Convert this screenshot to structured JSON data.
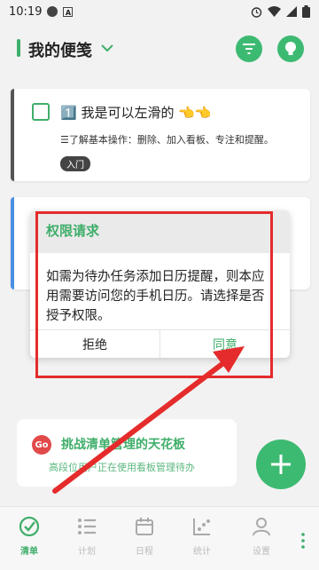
{
  "status_bar": {
    "time": "10:19",
    "badge_letter": "A"
  },
  "header": {
    "title": "我的便笺",
    "filter_icon": "filter-icon",
    "tip_icon": "lightbulb-icon"
  },
  "tasks": [
    {
      "title": "1️⃣ 我是可以左滑的 👈👈",
      "desc": "☰了解基本操作：删除、加入看板、专注和提醒。",
      "tag": "入门"
    }
  ],
  "dialog": {
    "title": "权限请求",
    "message": "如需为待办任务添加日历提醒，则本应用需要访问您的手机日历。请选择是否授予权限。",
    "deny_label": "拒绝",
    "allow_label": "同意"
  },
  "promo": {
    "badge": "Go",
    "title": "挑战清单管理的天花板",
    "subtitle": "高段位用户正在使用看板管理待办"
  },
  "bottom_nav": [
    {
      "label": "清单",
      "icon": "check-circle-icon"
    },
    {
      "label": "计划",
      "icon": "list-icon"
    },
    {
      "label": "日程",
      "icon": "calendar-icon"
    },
    {
      "label": "统计",
      "icon": "chart-icon"
    },
    {
      "label": "设置",
      "icon": "user-icon"
    }
  ],
  "colors": {
    "accent": "#3fae6a",
    "annotation": "#e52b2b"
  }
}
